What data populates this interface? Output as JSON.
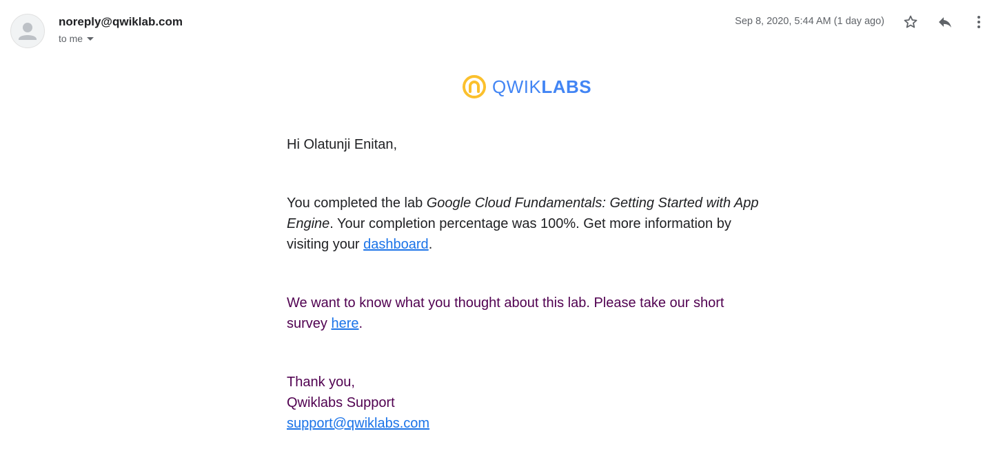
{
  "header": {
    "sender": "noreply@qwiklab.com",
    "recipient_label": "to me",
    "date": "Sep 8, 2020, 5:44 AM (1 day ago)",
    "icons": {
      "avatar": "person-icon",
      "star": "star-icon",
      "reply": "reply-icon",
      "more": "more-vert-icon"
    }
  },
  "logo": {
    "text_light": "QWIK",
    "text_bold": "LABS",
    "colors": {
      "ring": "#fbc02d",
      "text": "#4285f4"
    }
  },
  "body": {
    "greeting": "Hi Olatunji Enitan,",
    "para1_prefix": "You completed the lab ",
    "lab_name": "Google Cloud Fundamentals: Getting Started with App Engine",
    "para1_middle": ". Your completion percentage was 100%. Get more information by visiting your ",
    "dashboard_link": "dashboard",
    "para1_suffix": ".",
    "para2_prefix": "We want to know what you thought about this lab. Please take our short survey ",
    "survey_link": "here",
    "para2_suffix": ".",
    "thanks": "Thank you,",
    "signature": "Qwiklabs Support",
    "support_email": "support@qwiklabs.com"
  },
  "colors": {
    "link": "#1a73e8",
    "quoted_text": "#500050",
    "secondary_text": "#5f6368"
  }
}
